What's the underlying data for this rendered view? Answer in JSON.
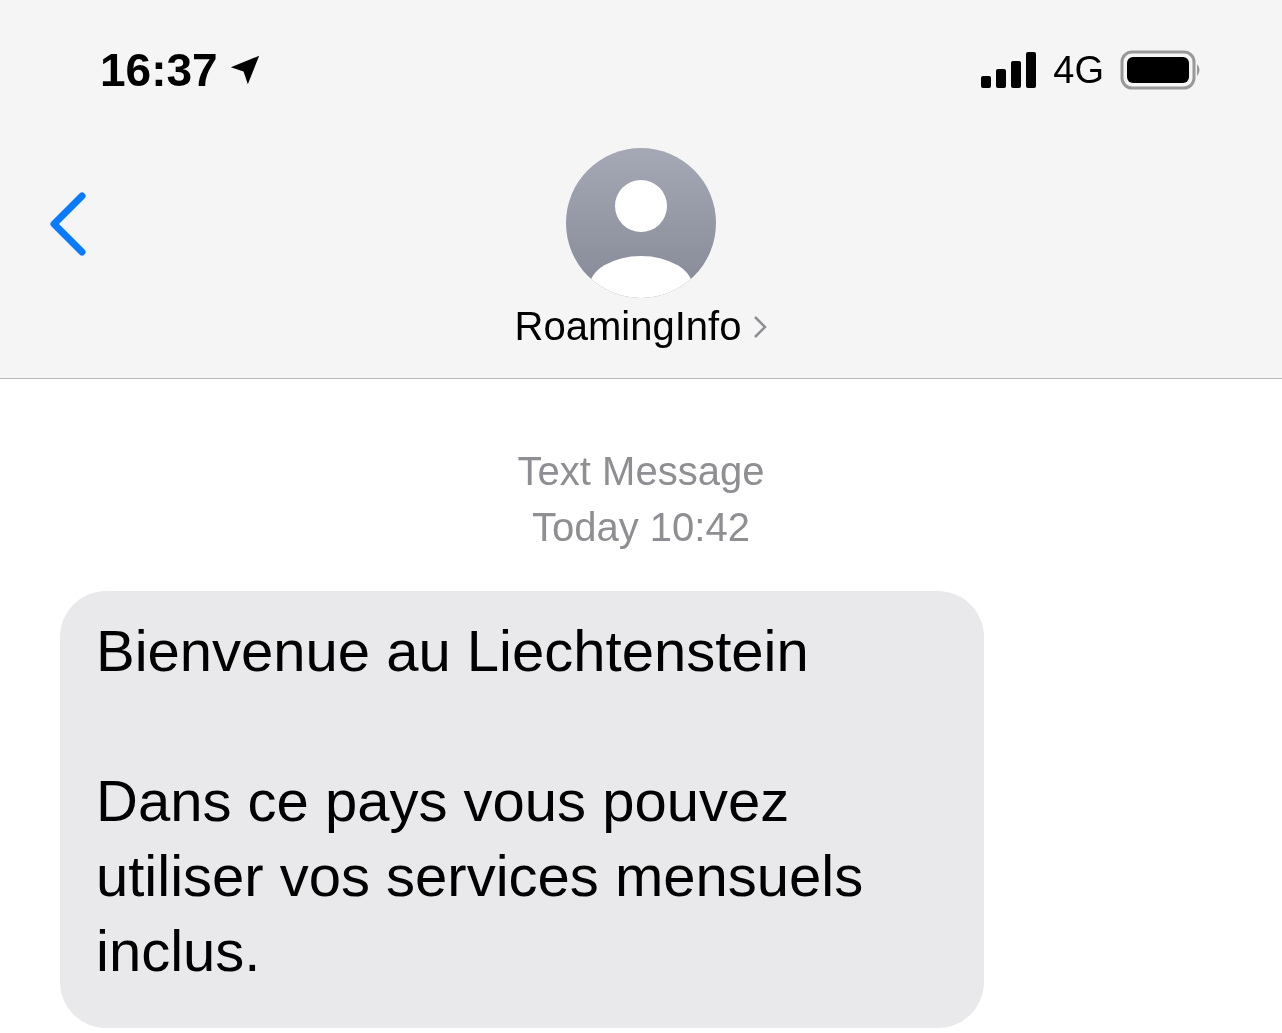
{
  "status_bar": {
    "time": "16:37",
    "network": "4G"
  },
  "header": {
    "contact_name": "RoamingInfo"
  },
  "thread": {
    "service_label": "Text Message",
    "timestamp": "Today 10:42"
  },
  "messages": [
    {
      "text": "Bienvenue au Liechtenstein\n\nDans ce pays vous pouvez utiliser vos services mensuels inclus."
    }
  ]
}
